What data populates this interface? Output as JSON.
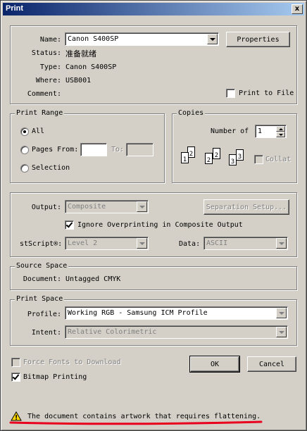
{
  "window": {
    "title": "Print",
    "close_glyph": "x"
  },
  "printer": {
    "name_label": "Name:",
    "name_value": "Canon S400SP",
    "properties_label": "Properties",
    "status_label": "Status:",
    "status_value": "准备就绪",
    "type_label": "Type:",
    "type_value": "Canon S400SP",
    "where_label": "Where:",
    "where_value": "USB001",
    "comment_label": "Comment:",
    "comment_value": "",
    "print_to_file_label": "Print to File"
  },
  "print_range": {
    "legend": "Print Range",
    "all_label": "All",
    "pages_from_label": "Pages From:",
    "to_label": "To:",
    "selection_label": "Selection"
  },
  "copies": {
    "legend": "Copies",
    "number_label": "Number of",
    "number_value": "1",
    "collate_label": "Collat"
  },
  "postscript": {
    "output_label": "Output:",
    "output_value": "Composite",
    "separation_setup_label": "Separation Setup...",
    "ignore_overprinting_label": "Ignore Overprinting in Composite Output",
    "level_label": "stScript®:",
    "level_value": "Level 2",
    "data_label": "Data:",
    "data_value": "ASCII"
  },
  "source_space": {
    "legend": "Source Space",
    "document_label": "Document:",
    "document_value": "Untagged CMYK"
  },
  "print_space": {
    "legend": "Print Space",
    "profile_label": "Profile:",
    "profile_value": "Working RGB - Samsung ICM Profile",
    "intent_label": "Intent:",
    "intent_value": "Relative Colorimetric"
  },
  "options": {
    "force_fonts_label": "Force Fonts to Download",
    "bitmap_printing_label": "Bitmap Printing"
  },
  "buttons": {
    "ok_label": "OK",
    "cancel_label": "Cancel"
  },
  "warning": {
    "icon": "warning-triangle",
    "text": "The document contains artwork that requires flattening.",
    "underline_color": "#e8001c"
  }
}
